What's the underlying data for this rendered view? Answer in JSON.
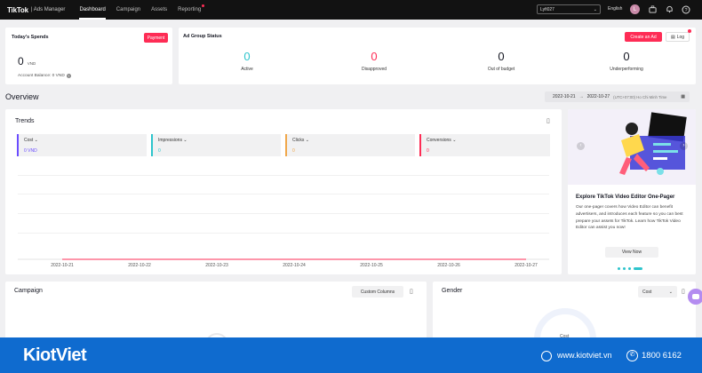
{
  "topbar": {
    "logo": "TikTok",
    "logo_sub": "| Ads Manager",
    "nav": [
      "Dashboard",
      "Campaign",
      "Assets",
      "Reporting"
    ],
    "account": "Lyfi027",
    "language": "English",
    "avatar_letter": "L"
  },
  "spend": {
    "title": "Today's Spends",
    "button": "Payment",
    "value": "0",
    "currency": "VND",
    "balance": "Account Balance: 0 VND"
  },
  "adgroup": {
    "title": "Ad Group Status",
    "create_button": "Create an Ad",
    "log_button": "Log",
    "stats": [
      {
        "value": "0",
        "label": "Active",
        "color": "#2ec4cc"
      },
      {
        "value": "0",
        "label": "Disapproved",
        "color": "#fe2c55"
      },
      {
        "value": "0",
        "label": "Out of budget",
        "color": "#161823"
      },
      {
        "value": "0",
        "label": "Underperforming",
        "color": "#161823"
      }
    ]
  },
  "overview": {
    "title": "Overview",
    "date_start": "2022-10-21",
    "date_end": "2022-10-27",
    "timezone": "(UTC+07:00) Ho Chi Minh Time"
  },
  "trends": {
    "title": "Trends",
    "metrics": [
      {
        "name": "Cost",
        "value": "0 VND",
        "color": "#6a4cff"
      },
      {
        "name": "Impressions",
        "value": "0",
        "color": "#2ec4cc"
      },
      {
        "name": "Clicks",
        "value": "0",
        "color": "#f0a74a"
      },
      {
        "name": "Conversions",
        "value": "0",
        "color": "#fe2c55"
      }
    ]
  },
  "chart_data": {
    "type": "line",
    "x": [
      "2022-10-21",
      "2022-10-22",
      "2022-10-23",
      "2022-10-24",
      "2022-10-25",
      "2022-10-26",
      "2022-10-27"
    ],
    "series": [
      {
        "values": [
          0,
          0,
          0,
          0,
          0,
          0,
          0
        ]
      }
    ],
    "grid": true
  },
  "promo": {
    "title": "Explore TikTok Video Editor One-Pager",
    "text": "Our one-pager covers how Video Editor can benefit advertisers, and introduces each feature so you can best prepare your assets for TikTok. Learn how TikTok Video Editor can assist you now!",
    "button": "View Now"
  },
  "campaign": {
    "title": "Campaign",
    "button": "Custom Columns"
  },
  "gender": {
    "title": "Gender",
    "select": "Cost",
    "donut_label": "Cost"
  },
  "banner": {
    "brand": "KiotViet",
    "website": "www.kiotviet.vn",
    "phone": "1800 6162"
  }
}
